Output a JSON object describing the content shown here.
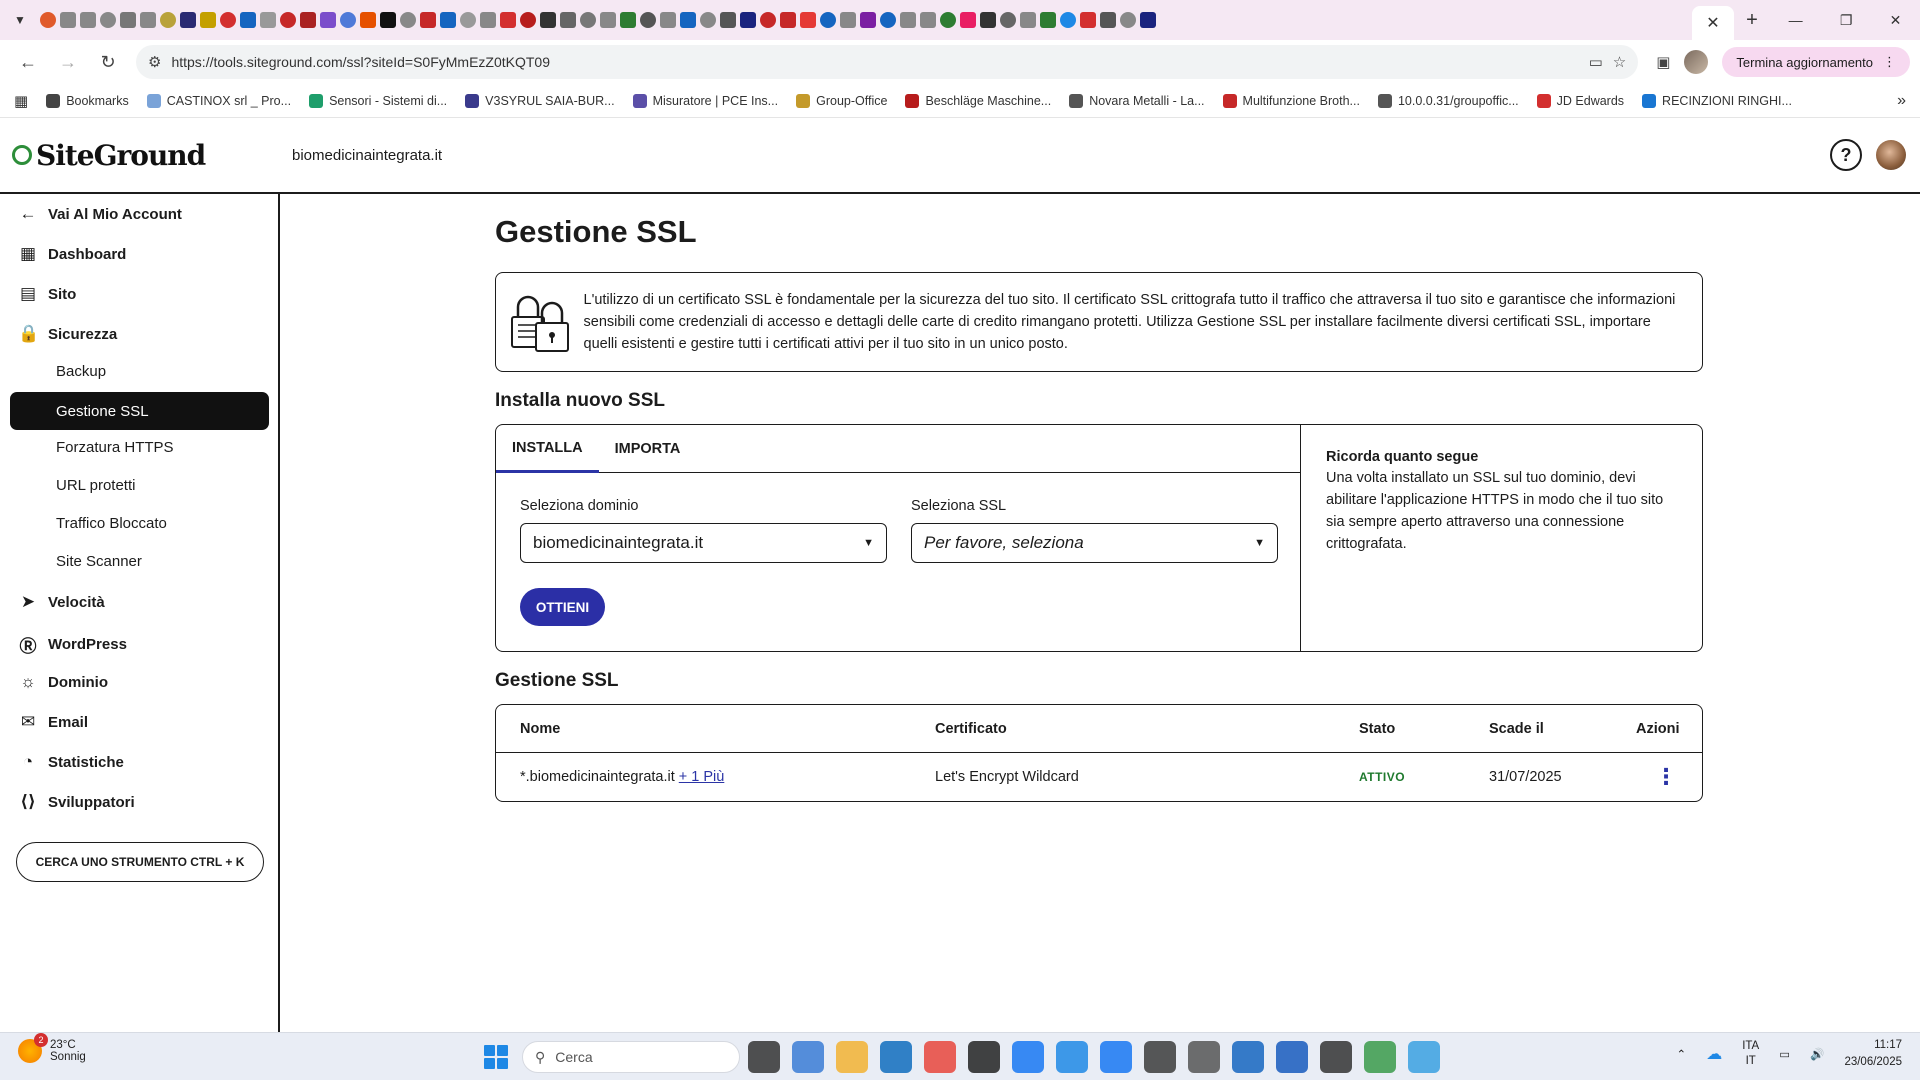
{
  "browser": {
    "url": "https://tools.siteground.com/ssl?siteId=S0FyMmEzZ0tKQT09",
    "update_label": "Termina aggiornamento",
    "tab_close_glyph": "✕",
    "new_tab_glyph": "+"
  },
  "bookmarks": [
    {
      "label": "Bookmarks",
      "color": "#444444"
    },
    {
      "label": "CASTINOX srl _ Pro...",
      "color": "#7aa3d8"
    },
    {
      "label": "Sensori - Sistemi di...",
      "color": "#1e9e6b"
    },
    {
      "label": "V3SYRUL SAIA-BUR...",
      "color": "#3a3a8c"
    },
    {
      "label": "Misuratore | PCE Ins...",
      "color": "#5b4fa8"
    },
    {
      "label": "Group-Office",
      "color": "#c49a2b"
    },
    {
      "label": "Beschläge Maschine...",
      "color": "#b71c1c"
    },
    {
      "label": "Novara Metalli - La...",
      "color": "#555555"
    },
    {
      "label": "Multifunzione Broth...",
      "color": "#c62828"
    },
    {
      "label": "10.0.0.31/groupoffic...",
      "color": "#555555"
    },
    {
      "label": "JD Edwards",
      "color": "#d32f2f"
    },
    {
      "label": "RECINZIONI RINGHI...",
      "color": "#1976d2"
    }
  ],
  "header": {
    "logo_text": "SiteGround",
    "domain": "biomedicinaintegrata.it",
    "help_glyph": "?"
  },
  "sidebar": {
    "back_label": "Vai Al Mio Account",
    "items": [
      {
        "label": "Dashboard",
        "icon": "grid-icon"
      },
      {
        "label": "Sito",
        "icon": "site-icon"
      },
      {
        "label": "Sicurezza",
        "icon": "lock-icon"
      }
    ],
    "security_sub": [
      "Backup",
      "Gestione SSL",
      "Forzatura HTTPS",
      "URL protetti",
      "Traffico Bloccato",
      "Site Scanner"
    ],
    "items_after": [
      {
        "label": "Velocità",
        "icon": "rocket-icon"
      },
      {
        "label": "WordPress",
        "icon": "wordpress-icon"
      },
      {
        "label": "Dominio",
        "icon": "globe-icon"
      },
      {
        "label": "Email",
        "icon": "mail-icon"
      },
      {
        "label": "Statistiche",
        "icon": "stats-icon"
      },
      {
        "label": "Sviluppatori",
        "icon": "code-icon"
      }
    ],
    "search_tool_label": "CERCA UNO STRUMENTO CTRL + K"
  },
  "main": {
    "title": "Gestione SSL",
    "info_text": "L'utilizzo di un certificato SSL è fondamentale per la sicurezza del tuo sito. Il certificato SSL crittografa tutto il traffico che attraversa il tuo sito e garantisce che informazioni sensibili come credenziali di accesso e dettagli delle carte di credito rimangano protetti. Utilizza Gestione SSL per installare facilmente diversi certificati SSL, importare quelli esistenti e gestire tutti i certificati attivi per il tuo sito in un unico posto.",
    "install_title": "Installa nuovo SSL",
    "tabs": [
      "INSTALLA",
      "IMPORTA"
    ],
    "domain_label": "Seleziona dominio",
    "domain_value": "biomedicinaintegrata.it",
    "ssl_label": "Seleziona SSL",
    "ssl_placeholder": "Per favore, seleziona",
    "get_button": "OTTIENI",
    "remember_title": "Ricorda quanto segue",
    "remember_text": "Una volta installato un SSL sul tuo dominio, devi abilitare l'applicazione HTTPS in modo che il tuo sito sia sempre aperto attraverso una connessione crittografata.",
    "manage_title": "Gestione SSL",
    "table": {
      "headers": [
        "Nome",
        "Certificato",
        "Stato",
        "Scade il",
        "Azioni"
      ],
      "rows": [
        {
          "name": "*.biomedicinaintegrata.it",
          "more": "+ 1 Più",
          "certificate": "Let's Encrypt Wildcard",
          "status": "ATTIVO",
          "expires": "31/07/2025"
        }
      ]
    }
  },
  "taskbar": {
    "temperature": "23°C",
    "weather": "Sonnig",
    "weather_badge": "2",
    "search_placeholder": "Cerca",
    "lang_top": "ITA",
    "lang_bottom": "IT",
    "time": "11:17",
    "date": "23/06/2025"
  }
}
